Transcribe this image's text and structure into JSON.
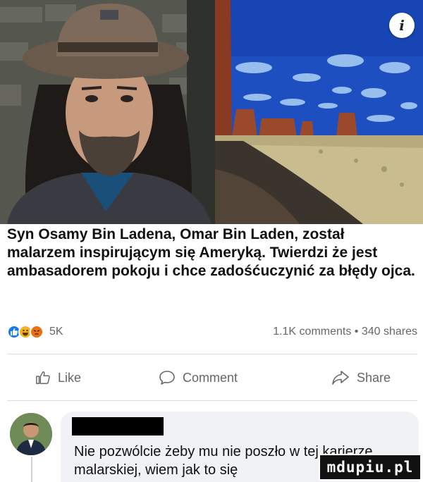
{
  "post": {
    "caption": "Syn Osamy Bin Ladena, Omar Bin Laden, został malarzem inspirującym się Ameryką. Twierdzi że jest ambasadorem pokoju i chce zadośćuczynić za błędy ojca.",
    "info_icon": "i"
  },
  "reactions": {
    "icons": [
      "like-icon",
      "haha-icon",
      "angry-icon"
    ],
    "count": "5K",
    "comments_shares": "1.1K comments • 340 shares"
  },
  "actions": {
    "like": "Like",
    "comment": "Comment",
    "share": "Share"
  },
  "comment": {
    "text": "Nie pozwólcie żeby mu nie poszło w tej karierze malarskiej, wiem jak to się"
  },
  "watermark": {
    "text": "mdupiu.pl"
  },
  "colors": {
    "like_blue": "#1877f2",
    "haha_yellow": "#f7b125",
    "angry_orange": "#e9710f",
    "muted_text": "#65676b",
    "sky_blue": "#1f4fb8"
  }
}
